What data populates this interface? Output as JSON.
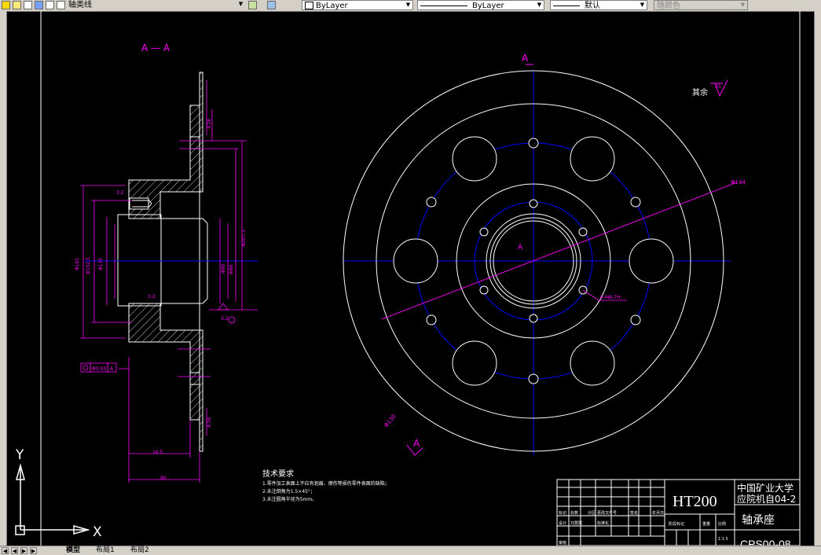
{
  "toolbar": {
    "layer_name": "轴类线",
    "color_by": "ByLayer",
    "linetype_by": "ByLayer",
    "lineweight": "默认",
    "plotstyle": "随颜色"
  },
  "tabs": {
    "model": "模型",
    "layout1": "布局1",
    "layout2": "布局2"
  },
  "drawing": {
    "section_label": "A — A",
    "view_label_a": "A",
    "view_label_a2": "A",
    "center_label": "A",
    "surface_note": "其余",
    "surface_value": "25",
    "dim_d144": "Φ144",
    "dim_d130": "Φ130",
    "dim_holes": "6-M8-7H",
    "dim_165": "16.5",
    "dim_80": "80",
    "dim_tol": "Φ0.03",
    "dim_ref": "A",
    "dim_32a": "3.2",
    "dim_32b": "3.2",
    "dim_32c": "3.2"
  },
  "notes": {
    "title": "技术要求",
    "line1": "1.零件加工表面上不应有划痕、擦伤等损伤零件表面的缺陷；",
    "line2": "2.未注倒角为1.5×45°；",
    "line3": "3.未注圆角半径为5mm。"
  },
  "title_block": {
    "material": "HT200",
    "school_line1": "中国矿业大学",
    "school_line2": "应院机自04-2",
    "part_name": "轴承座",
    "drawing_no": "CPS00-08",
    "h_mark": "标记",
    "h_count": "处数",
    "h_zone": "分区",
    "h_docno": "更改文件号",
    "h_sign": "签名",
    "h_date": "年月日",
    "h_stage": "阶段标记",
    "h_weight": "重量",
    "h_scale": "比例",
    "r_design": "设计",
    "r_check": "审核",
    "designer": "刘慧霞",
    "standard": "标准化",
    "scale_val": "1:1.5"
  },
  "ucs": {
    "x": "X",
    "y": "Y"
  },
  "colors": {
    "white": "#ffffff",
    "magenta": "#ff00ff",
    "blue": "#0000ff",
    "toolbar": "#d4d0c8"
  }
}
